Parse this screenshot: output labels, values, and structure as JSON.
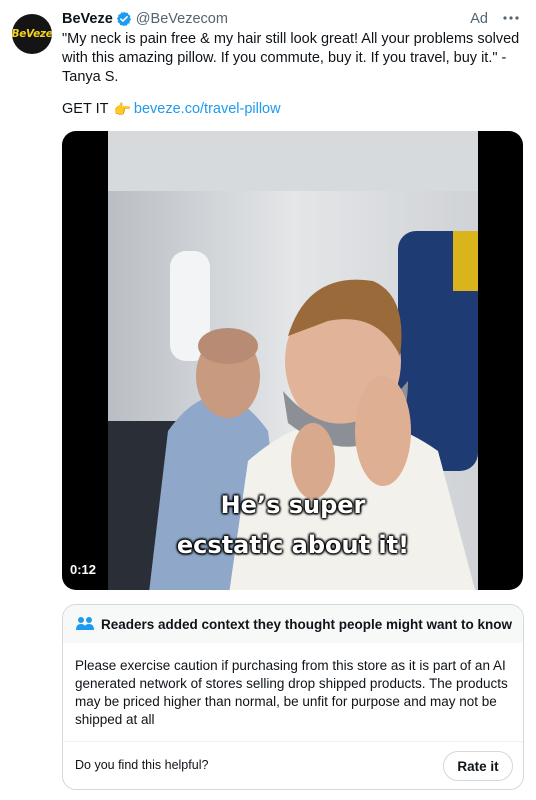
{
  "tweet": {
    "avatar_text": "BeVeze",
    "name": "BeVeze",
    "handle": "@BeVezecom",
    "ad_label": "Ad",
    "more_icon": "more-horizontal-icon",
    "text": "\"My neck is pain free & my hair still look great! All your problems solved with this amazing pillow. If you commute, buy it. If you travel, buy it.\" - Tanya S.",
    "cta_label": "GET IT",
    "cta_icon": "pointing-hand-icon",
    "cta_link": "beveze.co/travel-pillow",
    "accent_color": "#1d9bf0"
  },
  "video": {
    "caption_line1": "He’s super",
    "caption_line2": "ecstatic about it!",
    "duration": "0:12"
  },
  "community_note": {
    "header": "Readers added context they thought people might want to know",
    "header_icon": "people-icon",
    "body": "Please exercise caution if purchasing from this store as it is part of an AI generated network of stores selling drop shipped products. The products may be priced higher than normal, be unfit for purpose and may not be shipped at all",
    "helpful_question": "Do you find this helpful?",
    "rate_button": "Rate it"
  }
}
